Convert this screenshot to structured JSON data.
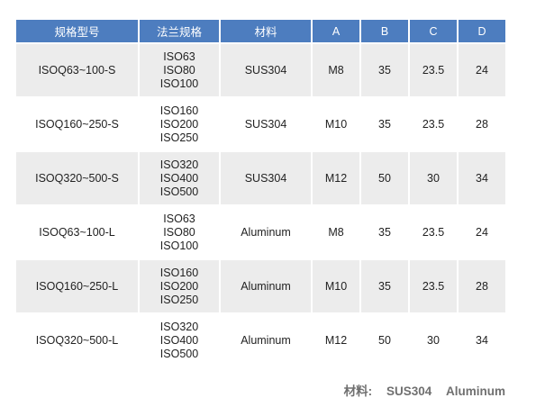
{
  "table": {
    "headers": [
      "规格型号",
      "法兰规格",
      "材料",
      "A",
      "B",
      "C",
      "D"
    ],
    "rows": [
      {
        "model": "ISOQ63~100-S",
        "flange": [
          "ISO63",
          "ISO80",
          "ISO100"
        ],
        "material": "SUS304",
        "a": "M8",
        "b": "35",
        "c": "23.5",
        "d": "24"
      },
      {
        "model": "ISOQ160~250-S",
        "flange": [
          "ISO160",
          "ISO200",
          "ISO250"
        ],
        "material": "SUS304",
        "a": "M10",
        "b": "35",
        "c": "23.5",
        "d": "28"
      },
      {
        "model": "ISOQ320~500-S",
        "flange": [
          "ISO320",
          "ISO400",
          "ISO500"
        ],
        "material": "SUS304",
        "a": "M12",
        "b": "50",
        "c": "30",
        "d": "34"
      },
      {
        "model": "ISOQ63~100-L",
        "flange": [
          "ISO63",
          "ISO80",
          "ISO100"
        ],
        "material": "Aluminum",
        "a": "M8",
        "b": "35",
        "c": "23.5",
        "d": "24"
      },
      {
        "model": "ISOQ160~250-L",
        "flange": [
          "ISO160",
          "ISO200",
          "ISO250"
        ],
        "material": "Aluminum",
        "a": "M10",
        "b": "35",
        "c": "23.5",
        "d": "28"
      },
      {
        "model": "ISOQ320~500-L",
        "flange": [
          "ISO320",
          "ISO400",
          "ISO500"
        ],
        "material": "Aluminum",
        "a": "M12",
        "b": "50",
        "c": "30",
        "d": "34"
      }
    ]
  },
  "note": {
    "label": "材料:",
    "material_1": "SUS304",
    "material_2": "Aluminum"
  },
  "colors": {
    "header_bg": "#4d7dbf",
    "stripe_bg": "#ececec",
    "note_text": "#707070"
  }
}
